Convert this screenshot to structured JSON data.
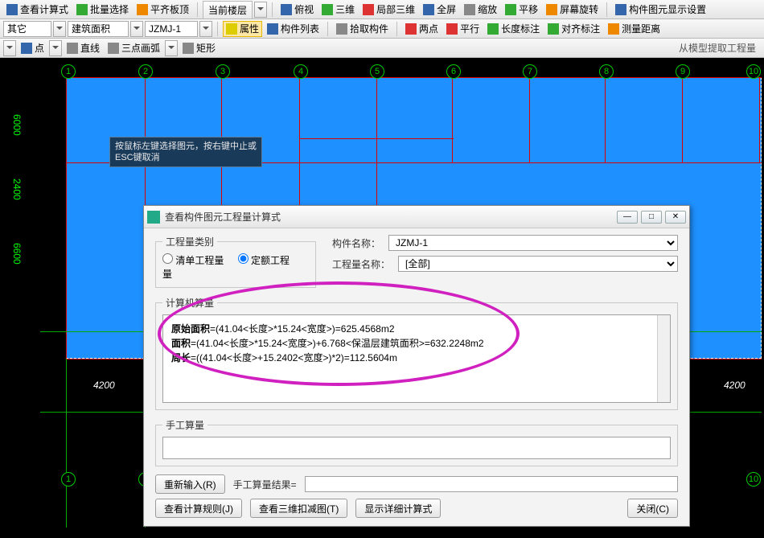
{
  "toolbar1": {
    "items": [
      "查看计算式",
      "批量选择",
      "平齐板顶"
    ],
    "tab_active": "当前楼层",
    "items2": [
      "俯视",
      "三维",
      "局部三维",
      "全屏",
      "缩放",
      "平移",
      "屏幕旋转",
      "构件图元显示设置"
    ]
  },
  "toolbar2": {
    "combo1": "其它",
    "combo2": "建筑面积",
    "combo3": "JZMJ-1",
    "btn_attr": "属性",
    "btn_list": "构件列表",
    "btn_pick": "拾取构件",
    "btn_2pt": "两点",
    "btn_parallel": "平行",
    "btn_lendim": "长度标注",
    "btn_aligndim": "对齐标注",
    "btn_measure": "测量距离"
  },
  "toolbar3": {
    "btn_point": "点",
    "btn_line": "直线",
    "btn_arc3": "三点画弧",
    "btn_rect": "矩形",
    "right_text": "从模型提取工程量"
  },
  "canvas": {
    "grid_nums_top": [
      "1",
      "2",
      "3",
      "4",
      "5",
      "6",
      "7",
      "8",
      "9",
      "10"
    ],
    "grid_nums_bottom": [
      "1",
      "2",
      "10"
    ],
    "axis_y": [
      "6000",
      "2400",
      "6600"
    ],
    "dim_bottom": "4200",
    "dim_bottom_r": "4200",
    "tooltip": "按鼠标左键选择图元，按右键中止或ESC键取消"
  },
  "dialog": {
    "title": "查看构件图元工程量计算式",
    "grp_type": "工程量类别",
    "radio_list": "清单工程量",
    "radio_quota": "定额工程量",
    "lbl_name": "构件名称：",
    "sel_name": "JZMJ-1",
    "lbl_qtyname": "工程量名称：",
    "sel_qtyname": "[全部]",
    "grp_calc": "计算机算量",
    "calc_lines": [
      {
        "b": "原始面积",
        "t": "=(41.04<长度>*15.24<宽度>)=625.4568m2"
      },
      {
        "b": "面积",
        "t": "=(41.04<长度>*15.24<宽度>)+6.768<保温层建筑面积>=632.2248m2"
      },
      {
        "b": "周长",
        "t": "=((41.04<长度>+15.2402<宽度>)*2)=112.5604m"
      }
    ],
    "grp_manual": "手工算量",
    "btn_reenter": "重新输入(R)",
    "lbl_manual_result": "手工算量结果=",
    "btn_rule": "查看计算规则(J)",
    "btn_3d": "查看三维扣减图(T)",
    "btn_detail": "显示详细计算式",
    "btn_close": "关闭(C)"
  }
}
